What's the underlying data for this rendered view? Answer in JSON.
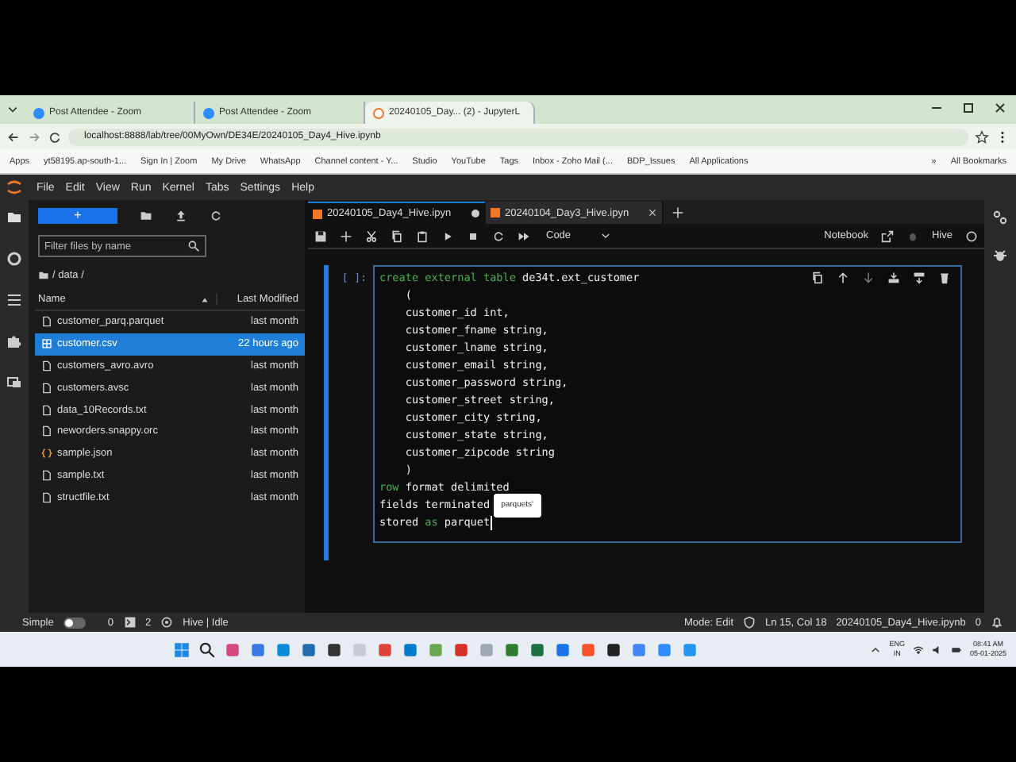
{
  "browser": {
    "tabs": [
      {
        "title": "Post Attendee - Zoom",
        "selected": false
      },
      {
        "title": "Post Attendee - Zoom",
        "selected": false
      },
      {
        "title": "20240105_Day... (2) - JupyterL",
        "selected": true
      }
    ],
    "url": "localhost:8888/lab/tree/00MyOwn/DE34E/20240105_Day4_Hive.ipynb",
    "bookmarks": [
      "Apps",
      "yt58195.ap-south-1...",
      "Sign In | Zoom",
      "My Drive",
      "WhatsApp",
      "Channel content - Y...",
      "Studio",
      "YouTube",
      "Tags",
      "Inbox - Zoho Mail (...",
      "BDP_Issues",
      "All Applications"
    ],
    "more": "»",
    "all_bookmarks": "All Bookmarks"
  },
  "menu": [
    "File",
    "Edit",
    "View",
    "Run",
    "Kernel",
    "Tabs",
    "Settings",
    "Help"
  ],
  "file_browser": {
    "new_button": "+",
    "filter_placeholder": "Filter files by name",
    "path": "/ data /",
    "columns": [
      "Name",
      "Last Modified"
    ],
    "files": [
      {
        "name": "customer_parq.parquet",
        "modified": "last month",
        "kind": "file",
        "selected": false
      },
      {
        "name": "customer.csv",
        "modified": "22 hours ago",
        "kind": "table",
        "selected": true
      },
      {
        "name": "customers_avro.avro",
        "modified": "last month",
        "kind": "file",
        "selected": false
      },
      {
        "name": "customers.avsc",
        "modified": "last month",
        "kind": "file",
        "selected": false
      },
      {
        "name": "data_10Records.txt",
        "modified": "last month",
        "kind": "file",
        "selected": false
      },
      {
        "name": "neworders.snappy.orc",
        "modified": "last month",
        "kind": "file",
        "selected": false
      },
      {
        "name": "sample.json",
        "modified": "last month",
        "kind": "json",
        "selected": false
      },
      {
        "name": "sample.txt",
        "modified": "last month",
        "kind": "file",
        "selected": false
      },
      {
        "name": "structfile.txt",
        "modified": "last month",
        "kind": "file",
        "selected": false
      }
    ]
  },
  "notebook": {
    "tabs": [
      {
        "title": "20240105_Day4_Hive.ipyn",
        "selected": true,
        "modified": true
      },
      {
        "title": "20240104_Day3_Hive.ipyn",
        "selected": false,
        "modified": false
      }
    ],
    "cell_type": "Code",
    "mode_label": "Notebook",
    "kernel": "Hive",
    "prompt": "[ ]:",
    "code": [
      {
        "tokens": [
          {
            "kind": "keyword",
            "text": "create external table"
          },
          {
            "kind": "plain",
            "text": " de34t.ext_customer"
          }
        ]
      },
      {
        "tokens": [
          {
            "kind": "plain",
            "text": "    ("
          }
        ]
      },
      {
        "tokens": [
          {
            "kind": "plain",
            "text": "    customer_id int,"
          }
        ]
      },
      {
        "tokens": [
          {
            "kind": "plain",
            "text": "    customer_fname string,"
          }
        ]
      },
      {
        "tokens": [
          {
            "kind": "plain",
            "text": "    customer_lname string,"
          }
        ]
      },
      {
        "tokens": [
          {
            "kind": "plain",
            "text": "    customer_email string,"
          }
        ]
      },
      {
        "tokens": [
          {
            "kind": "plain",
            "text": "    customer_password string,"
          }
        ]
      },
      {
        "tokens": [
          {
            "kind": "plain",
            "text": "    customer_street string,"
          }
        ]
      },
      {
        "tokens": [
          {
            "kind": "plain",
            "text": "    customer_city string,"
          }
        ]
      },
      {
        "tokens": [
          {
            "kind": "plain",
            "text": "    customer_state string,"
          }
        ]
      },
      {
        "tokens": [
          {
            "kind": "plain",
            "text": "    customer_zipcode string"
          }
        ]
      },
      {
        "tokens": [
          {
            "kind": "plain",
            "text": "    )"
          }
        ]
      },
      {
        "tokens": [
          {
            "kind": "keyword",
            "text": "row"
          },
          {
            "kind": "plain",
            "text": " format delimited"
          }
        ]
      },
      {
        "tokens": [
          {
            "kind": "plain",
            "text": "fields terminated"
          }
        ]
      },
      {
        "tokens": [
          {
            "kind": "plain",
            "text": "stored "
          },
          {
            "kind": "keyword",
            "text": "as"
          },
          {
            "kind": "plain",
            "text": " parquet"
          }
        ]
      }
    ],
    "completion": "parquets'"
  },
  "status": {
    "simple_label": "Simple",
    "simple_on": false,
    "terminals": "0",
    "kernels": "2",
    "kernel_state": "Hive | Idle",
    "mode": "Mode: Edit",
    "position": "Ln 15, Col 18",
    "file": "20240105_Day4_Hive.ipynb",
    "notifications": "0"
  },
  "taskbar": {
    "language": "ENG",
    "region": "IN",
    "time": "08:41 AM",
    "date": "05-01-2025"
  }
}
